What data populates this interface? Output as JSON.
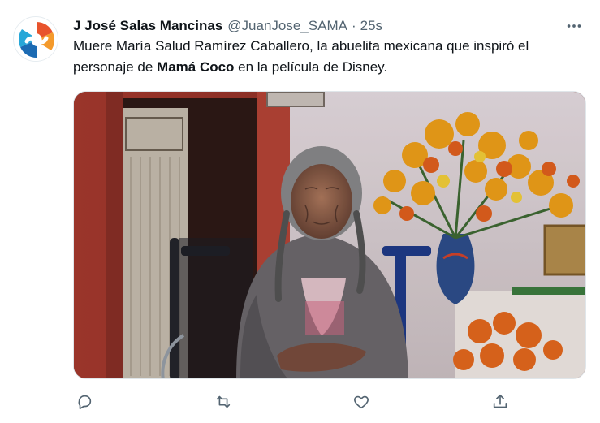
{
  "tweet": {
    "author_name": "J José Salas Mancinas",
    "handle": "@JuanJose_SAMA",
    "separator": "·",
    "timestamp": "25s",
    "text_part1": "Muere María Salud Ramírez Caballero, la abuelita mexicana que inspiró el personaje de ",
    "text_bold": "Mamá Coco",
    "text_part2": " en la película de Disney.",
    "media_kind": "photo"
  },
  "icons": {
    "avatar": "logo-s-icon",
    "more": "more-dots-icon",
    "reply": "reply-icon",
    "retweet": "retweet-icon",
    "like": "heart-icon",
    "share": "share-icon"
  },
  "colors": {
    "text": "#0f1419",
    "secondary": "#536471",
    "border": "#e0e6ea"
  }
}
